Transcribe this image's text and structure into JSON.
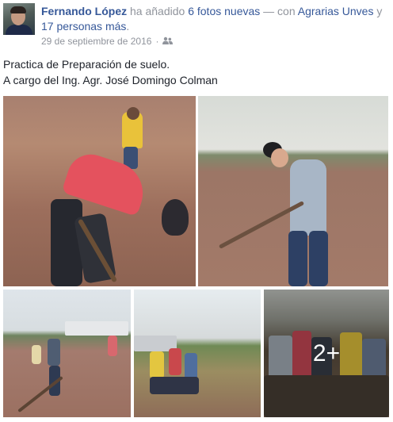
{
  "post": {
    "author": "Fernando López",
    "action_prefix": "ha añadido",
    "photos_link": "6 fotos nuevas",
    "separator": "— con",
    "tagged_person": "Agrarias Unves",
    "conjunction": "y",
    "others_link": "17 personas más",
    "period": ".",
    "timestamp": "29 de septiembre de 2016",
    "audience_icon": "friends-icon",
    "text_line1": "Practica de Preparación de suelo.",
    "text_line2": "A cargo del Ing. Agr. José Domingo Colman"
  },
  "gallery": {
    "more_overlay": "2+"
  },
  "colors": {
    "link": "#365899",
    "meta": "#90949c",
    "text": "#1d2129"
  }
}
